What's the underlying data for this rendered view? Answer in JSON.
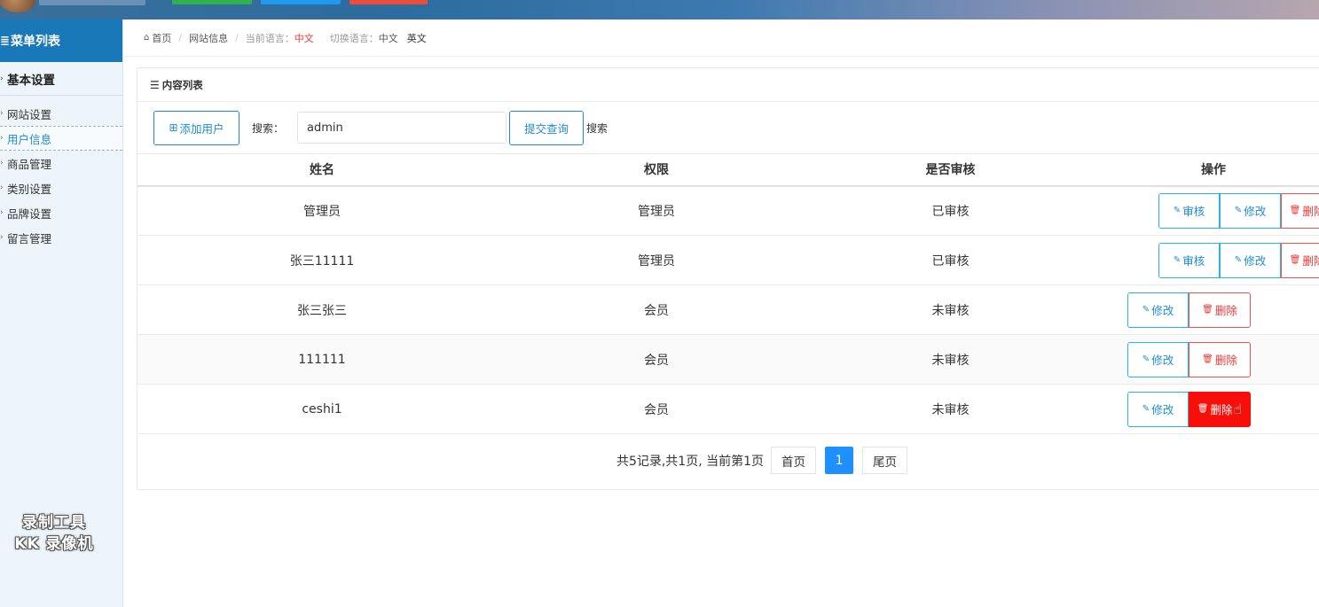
{
  "sidebar": {
    "title": "菜单列表",
    "group_title": "基本设置",
    "items": [
      {
        "label": "网站设置"
      },
      {
        "label": "用户信息"
      },
      {
        "label": "商品管理"
      },
      {
        "label": "类别设置"
      },
      {
        "label": "品牌设置"
      },
      {
        "label": "留言管理"
      }
    ],
    "watermark_line1": "录制工具",
    "watermark_line2": "KK 录像机"
  },
  "breadcrumb": {
    "home": "首页",
    "current": "网站信息",
    "current_lang_label": "当前语言：",
    "current_lang_value": "中文",
    "switch_lang_label": "切换语言：",
    "lang_zh": "中文",
    "lang_en": "英文"
  },
  "panel": {
    "title": "内容列表"
  },
  "toolbar": {
    "add_label": "添加用户",
    "search_label": "搜索：",
    "search_value": "admin",
    "submit_label": "提交查询",
    "search_text": "搜索"
  },
  "table": {
    "columns": [
      "姓名",
      "权限",
      "是否审核",
      "操作"
    ],
    "actions": {
      "audit": "审核",
      "edit": "修改",
      "delete": "删除"
    },
    "rows": [
      {
        "name": "管理员",
        "role": "管理员",
        "status": "已审核"
      },
      {
        "name": "张三11111",
        "role": "管理员",
        "status": "已审核"
      },
      {
        "name": "张三张三",
        "role": "会员",
        "status": "未审核"
      },
      {
        "name": "111111",
        "role": "会员",
        "status": "未审核"
      },
      {
        "name": "ceshi1",
        "role": "会员",
        "status": "未审核"
      }
    ]
  },
  "pagination": {
    "summary": "共5记录,共1页, 当前第1页",
    "first": "首页",
    "current": "1",
    "last": "尾页"
  },
  "colors": {
    "accent": "#1e8bd6",
    "sidebar_header": "#1878b8",
    "danger": "#e53935",
    "success": "#1a8a1a"
  }
}
